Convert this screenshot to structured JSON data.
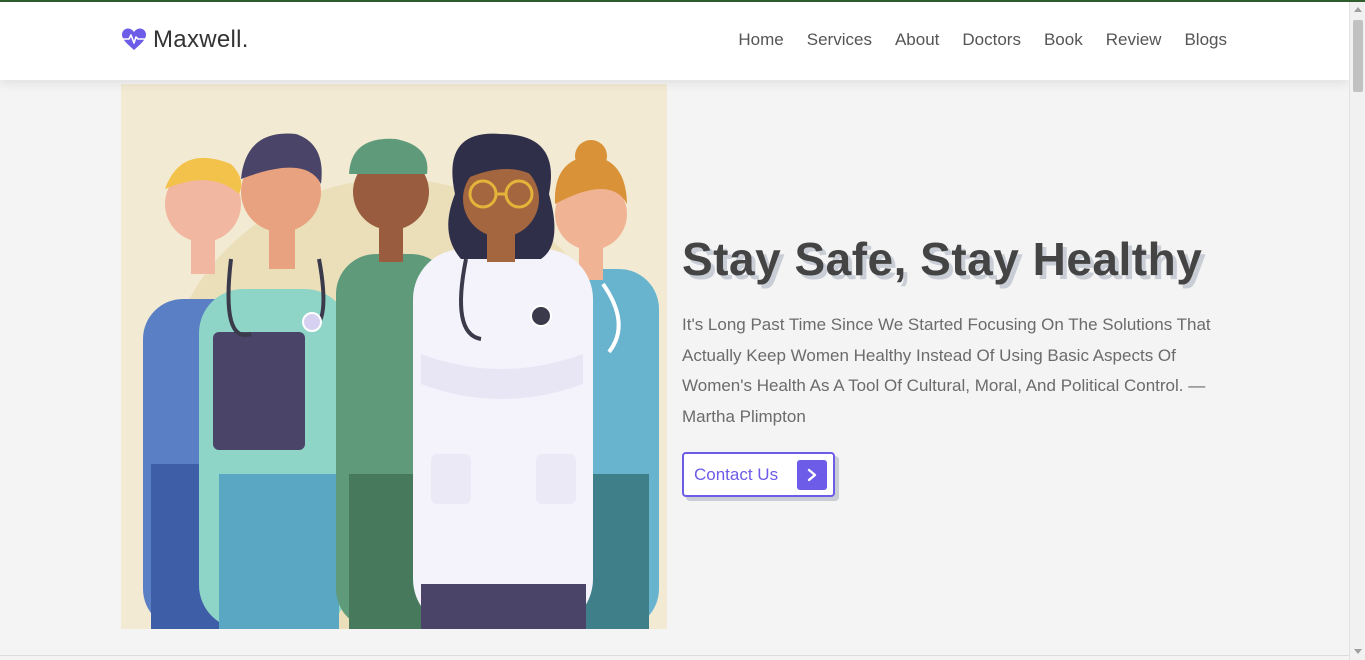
{
  "brand": {
    "name": "Maxwell.",
    "icon": "heartbeat-icon",
    "color": "#6c5ce7"
  },
  "nav": {
    "items": [
      {
        "label": "Home"
      },
      {
        "label": "Services"
      },
      {
        "label": "About"
      },
      {
        "label": "Doctors"
      },
      {
        "label": "Book"
      },
      {
        "label": "Review"
      },
      {
        "label": "Blogs"
      }
    ]
  },
  "hero": {
    "title": "Stay Safe, Stay Healthy",
    "text": "It's Long Past Time Since We Started Focusing On The Solutions That Actually Keep Women Healthy Instead Of Using Basic Aspects Of Women's Health As A Tool Of Cultural, Moral, And Political Control. — Martha Plimpton",
    "button_label": "Contact Us",
    "button_icon": "chevron-right-icon",
    "image": "medical-team-illustration"
  },
  "colors": {
    "accent": "#6c5ce7",
    "title": "#444444",
    "text": "#6b6b6b",
    "background": "#f4f4f4"
  }
}
